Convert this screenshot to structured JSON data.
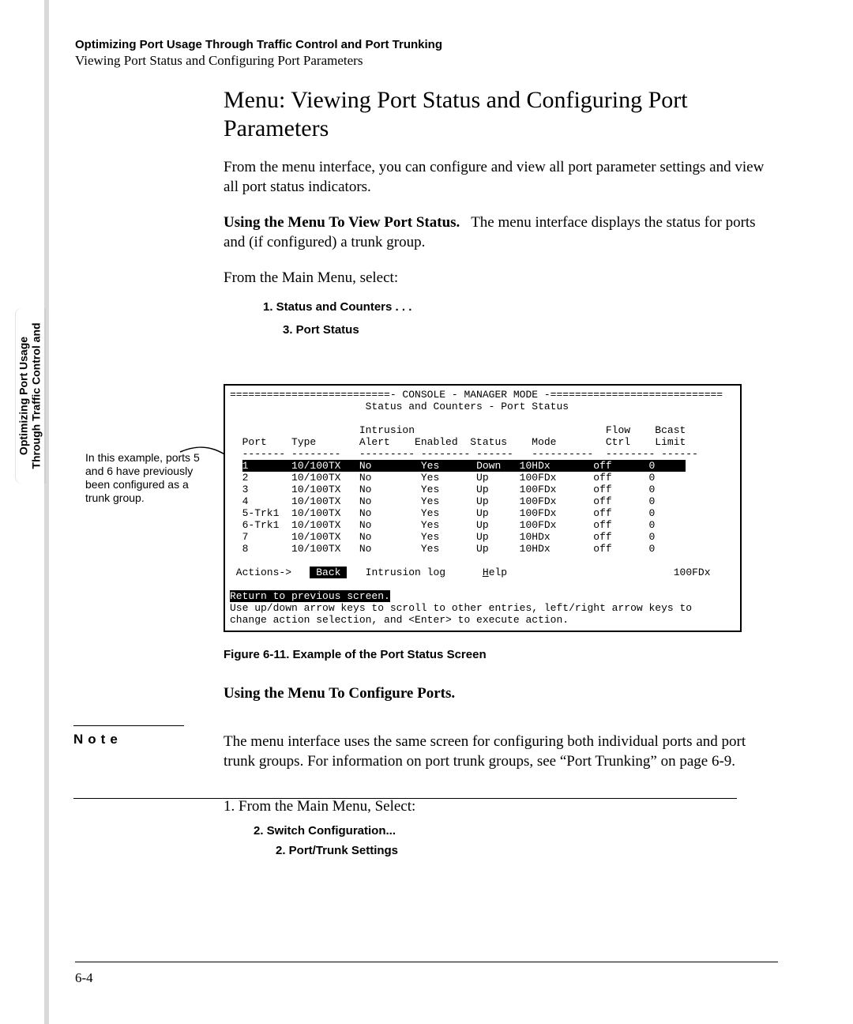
{
  "header": {
    "bold_line": "Optimizing Port Usage Through Traffic Control and Port Trunking",
    "sub_line": "Viewing Port Status and Configuring Port Parameters"
  },
  "side_tab": {
    "line1": "Optimizing Port Usage",
    "line2": "Through Traffic Control and"
  },
  "main": {
    "title": "Menu: Viewing Port Status and Configuring Port Parameters",
    "intro": "From the menu interface, you can configure and view all port parameter settings and view all port status indicators.",
    "view_heading": "Using the Menu To View Port Status.",
    "view_body": "The menu interface displays the status for ports and (if  configured) a trunk group.",
    "from_main": "From the Main Menu, select:",
    "step1": "1. Status and Counters . . .",
    "step2": "3. Port Status",
    "callout": "In this example, ports 5 and 6 have previously been configured as a trunk group.",
    "figure_caption": "Figure 6-11.  Example of the Port Status Screen",
    "configure_heading": "Using the Menu To Configure Ports.",
    "note_label": "Note",
    "note_body": "The menu interface uses the same screen for configuring both individual ports and port trunk groups. For information on port trunk groups, see “Port Trunking” on page 6-9.",
    "ol_1": "1.   From the Main Menu, Select:",
    "ol_1a": "2. Switch Configuration...",
    "ol_1b": "2. Port/Trunk Settings"
  },
  "console": {
    "top_bar": "==========================- CONSOLE - MANAGER MODE -============================",
    "title_line": "                      Status and Counters - Port Status",
    "blank": "",
    "hdr1": "                     Intrusion                               Flow    Bcast",
    "hdr2": "  Port    Type       Alert    Enabled  Status    Mode        Ctrl    Limit",
    "dash": "  ------- --------   --------- -------- ------   ----------  -------- ------",
    "rows": [
      [
        "1",
        "10/100TX",
        "No",
        "Yes",
        "Down",
        "10HDx",
        "off",
        "0"
      ],
      [
        "2",
        "10/100TX",
        "No",
        "Yes",
        "Up",
        "100FDx",
        "off",
        "0"
      ],
      [
        "3",
        "10/100TX",
        "No",
        "Yes",
        "Up",
        "100FDx",
        "off",
        "0"
      ],
      [
        "4",
        "10/100TX",
        "No",
        "Yes",
        "Up",
        "100FDx",
        "off",
        "0"
      ],
      [
        "5-Trk1",
        "10/100TX",
        "No",
        "Yes",
        "Up",
        "100FDx",
        "off",
        "0"
      ],
      [
        "6-Trk1",
        "10/100TX",
        "No",
        "Yes",
        "Up",
        "100FDx",
        "off",
        "0"
      ],
      [
        "7",
        "10/100TX",
        "No",
        "Yes",
        "Up",
        "10HDx",
        "off",
        "0"
      ],
      [
        "8",
        "10/100TX",
        "No",
        "Yes",
        "Up",
        "10HDx",
        "off",
        "0"
      ]
    ],
    "actions_label": " Actions->   ",
    "actions_back": "Back",
    "actions_rest1": "   Intrusion log      ",
    "actions_help_initial": "H",
    "actions_help_rest": "elp",
    "actions_right": "100FDx",
    "return_line": "Return to previous screen.",
    "hint1": "Use up/down arrow keys to scroll to other entries, left/right arrow keys to",
    "hint2": "change action selection, and <Enter> to execute action."
  },
  "footer": {
    "page": "6-4"
  }
}
